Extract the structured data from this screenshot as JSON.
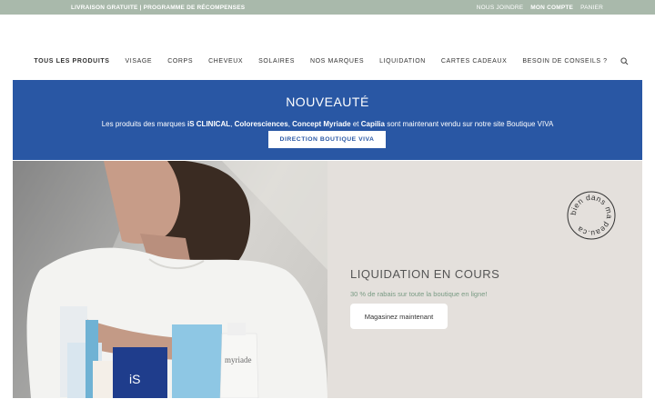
{
  "topbar": {
    "promo": "LIVRAISON GRATUITE | PROGRAMME DE RÉCOMPENSES",
    "links": [
      "NOUS JOINDRE",
      "MON COMPTE",
      "PANIER"
    ]
  },
  "nav": {
    "items": [
      "TOUS LES PRODUITS",
      "VISAGE",
      "CORPS",
      "CHEVEUX",
      "SOLAIRES",
      "NOS MARQUES",
      "LIQUIDATION",
      "CARTES CADEAUX",
      "BESOIN DE CONSEILS ?"
    ]
  },
  "banner": {
    "heading": "NOUVEAUTÉ",
    "desc_prefix": "Les produits des marques ",
    "brand1": "iS CLINICAL",
    "sep1": ", ",
    "brand2": "Coloresciences",
    "sep2": ", ",
    "brand3": "Concept Myriade",
    "sep3": " et ",
    "brand4": "Capilia",
    "desc_suffix": " sont maintenant vendu sur notre site Boutique VIVA",
    "button": "DIRECTION BOUTIQUE VIVA",
    "bg_color": "#2957a4"
  },
  "hero": {
    "stamp_text": "bien dans ma peau.ca",
    "title": "LIQUIDATION EN COURS",
    "subtitle": "30 % de rabais sur toute la boutique en ligne!",
    "button": "Magasinez maintenant",
    "product_labels": [
      "iS",
      "myriade"
    ]
  },
  "colors": {
    "topbar": "#a9b9ab",
    "panel": "#e4e0dc",
    "accent_green": "#7a9b84"
  }
}
